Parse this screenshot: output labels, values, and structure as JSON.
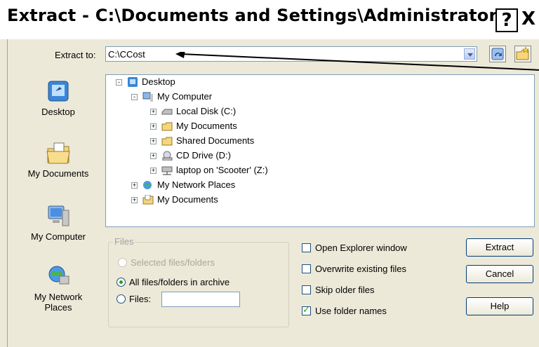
{
  "window": {
    "title": "Extract - C:\\Documents and Settings\\Administrator\\Des...",
    "help_label": "?",
    "close_label": "X"
  },
  "extract_to": {
    "label": "Extract to:",
    "value": "C:\\CCost"
  },
  "places": [
    {
      "label": "Desktop",
      "icon": "desktop-icon"
    },
    {
      "label": "My Documents",
      "icon": "my-documents-icon"
    },
    {
      "label": "My Computer",
      "icon": "my-computer-icon"
    },
    {
      "label": "My Network Places",
      "icon": "network-places-icon"
    }
  ],
  "tree": [
    {
      "label": "Desktop",
      "icon": "desktop-icon",
      "expander": "-"
    },
    {
      "label": "My Computer",
      "icon": "my-computer-icon",
      "expander": "-"
    },
    {
      "label": "Local Disk (C:)",
      "icon": "drive-icon",
      "expander": "+"
    },
    {
      "label": "My Documents",
      "icon": "folder-icon",
      "expander": "+"
    },
    {
      "label": "Shared Documents",
      "icon": "folder-icon",
      "expander": "+"
    },
    {
      "label": "CD Drive (D:)",
      "icon": "cd-drive-icon",
      "expander": "+"
    },
    {
      "label": "laptop on 'Scooter' (Z:)",
      "icon": "network-drive-icon",
      "expander": "+"
    },
    {
      "label": "My Network Places",
      "icon": "network-places-icon",
      "expander": "+"
    },
    {
      "label": "My Documents",
      "icon": "my-documents-icon",
      "expander": "+"
    }
  ],
  "files_group": {
    "title": "Files",
    "options": [
      {
        "label": "Selected files/folders",
        "state": "disabled"
      },
      {
        "label": "All files/folders in archive",
        "state": "checked"
      },
      {
        "label": "Files:",
        "state": "unchecked"
      }
    ],
    "files_value": ""
  },
  "checkboxes": [
    {
      "label": "Open Explorer window",
      "checked": false
    },
    {
      "label": "Overwrite existing files",
      "checked": false
    },
    {
      "label": "Skip older files",
      "checked": false
    },
    {
      "label": "Use folder names",
      "checked": true
    }
  ],
  "buttons": {
    "extract": "Extract",
    "cancel": "Cancel",
    "help": "Help"
  }
}
